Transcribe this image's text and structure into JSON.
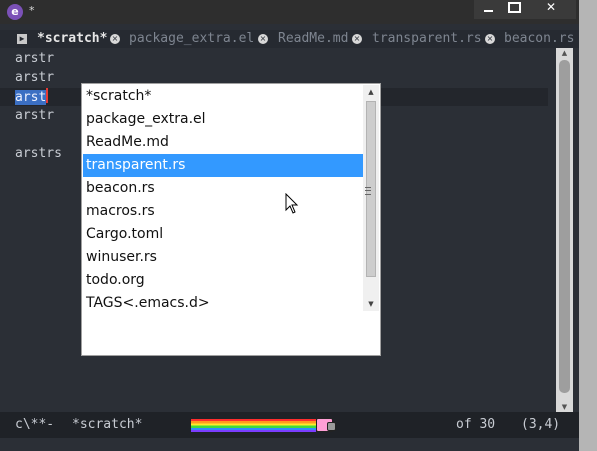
{
  "window": {
    "title": "*",
    "app_icon": "emacs-icon",
    "controls": {
      "minimize": "minimize-icon",
      "maximize": "maximize-icon",
      "close": "close-icon"
    }
  },
  "tabs": {
    "menu_icon": "tab-menu-icon",
    "items": [
      {
        "label": "*scratch*",
        "active": true
      },
      {
        "label": "package_extra.el",
        "active": false
      },
      {
        "label": "ReadMe.md",
        "active": false
      },
      {
        "label": "transparent.rs",
        "active": false
      },
      {
        "label": "beacon.rs",
        "active": false
      }
    ]
  },
  "editor": {
    "lines": [
      "arstr",
      "arstr",
      "arst",
      "arstr",
      "",
      "arstrs"
    ],
    "current_line_index": 2
  },
  "popup": {
    "items": [
      "*scratch*",
      "package_extra.el",
      "ReadMe.md",
      "transparent.rs",
      "beacon.rs",
      "macros.rs",
      "Cargo.toml",
      "winuser.rs",
      "todo.org",
      "TAGS<.emacs.d>"
    ],
    "selected_index": 3
  },
  "modeline": {
    "status": "c\\**-",
    "buffer": "*scratch*",
    "position": "of 30",
    "cursor": "(3,4)"
  },
  "colors": {
    "background": "#2b2f36",
    "selection": "#3b6fc3",
    "popup_selection": "#3399ff",
    "cursor": "#e53935"
  }
}
